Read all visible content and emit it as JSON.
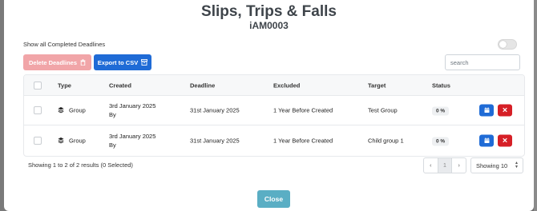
{
  "modal": {
    "title": "Slips, Trips & Falls",
    "subtitle": "iAM0003"
  },
  "controls": {
    "show_completed_label": "Show all Completed Deadlines",
    "show_completed_on": false,
    "delete_label": "Delete Deadlines",
    "export_label": "Export to CSV",
    "search_placeholder": "search",
    "search_value": ""
  },
  "table": {
    "columns": [
      "",
      "Type",
      "Created",
      "Deadline",
      "Excluded",
      "Target",
      "Status",
      ""
    ],
    "rows": [
      {
        "type": "Group",
        "created": "3rd January 2025",
        "created_by": "By",
        "deadline": "31st January 2025",
        "excluded": "1 Year Before Created",
        "target": "Test Group",
        "status": "0 %"
      },
      {
        "type": "Group",
        "created": "3rd January 2025",
        "created_by": "By",
        "deadline": "31st January 2025",
        "excluded": "1 Year Before Created",
        "target": "Child group 1",
        "status": "0 %"
      }
    ]
  },
  "footer": {
    "summary": "Showing 1 to 2 of 2 results (0 Selected)",
    "prev": "‹",
    "current_page": "1",
    "next": "›",
    "per_page": "Showing 10",
    "close_label": "Close"
  },
  "colors": {
    "primary": "#1f6bd6",
    "danger": "#d61f26",
    "danger_disabled": "#f1a5a8",
    "close": "#5aaec4"
  }
}
